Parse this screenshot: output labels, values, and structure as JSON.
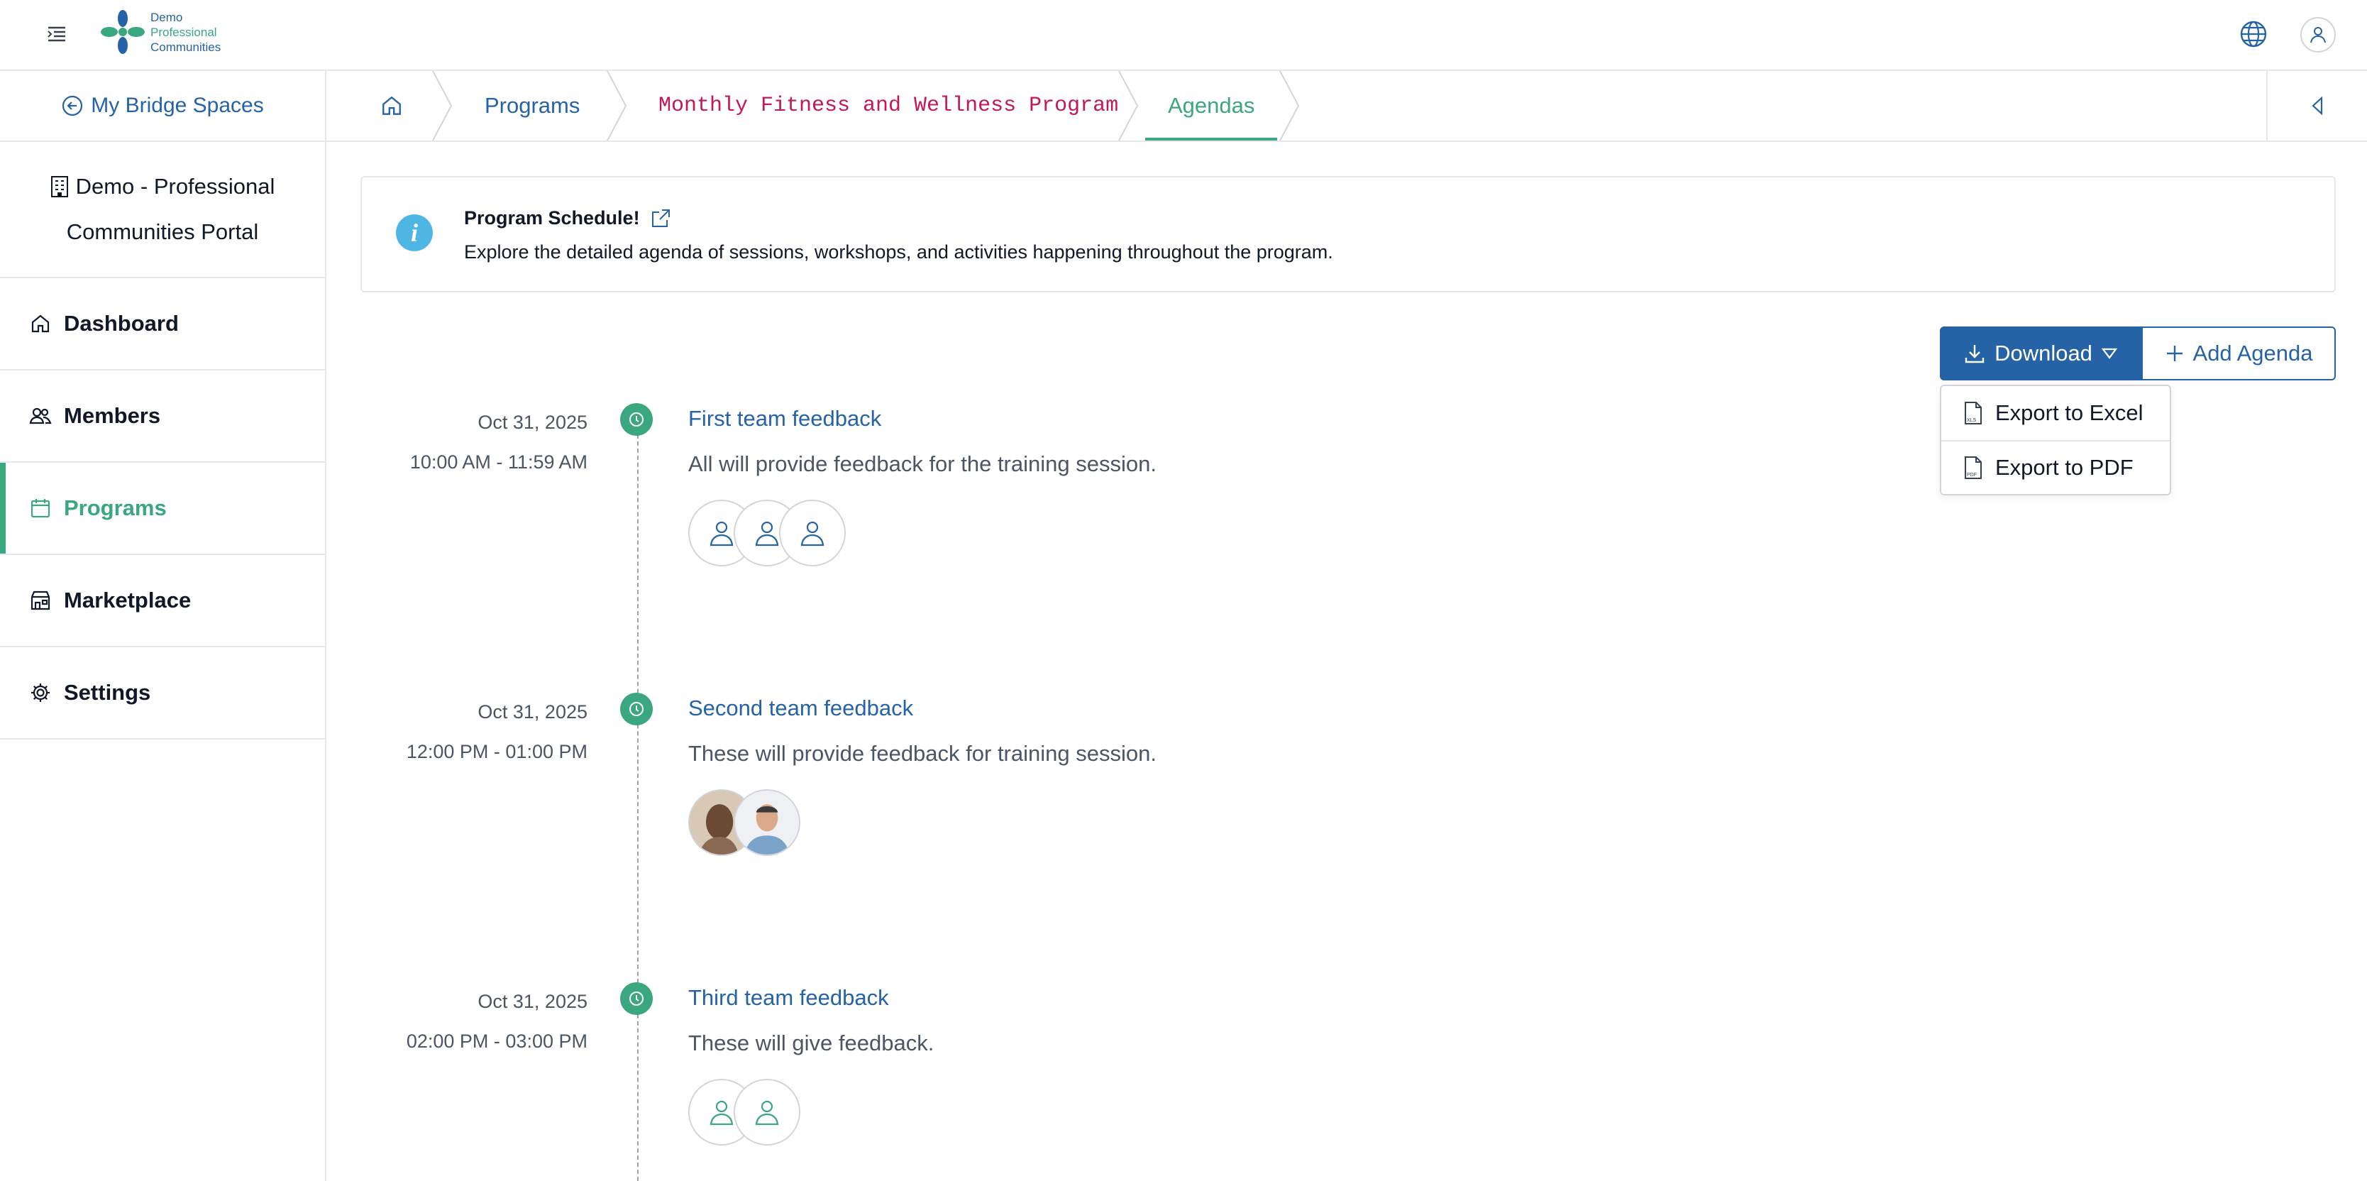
{
  "header": {
    "logo": {
      "line1": "Demo",
      "line2": "Professional",
      "line3": "Communities"
    },
    "icons": [
      "menu-toggle-icon",
      "globe-icon",
      "user-icon"
    ]
  },
  "sidebar": {
    "back_label": "My Bridge Spaces",
    "org_line1": "Demo - Professional",
    "org_line2": "Communities Portal",
    "items": [
      {
        "label": "Dashboard",
        "icon": "home-icon",
        "active": false
      },
      {
        "label": "Members",
        "icon": "users-icon",
        "active": false
      },
      {
        "label": "Programs",
        "icon": "calendar-icon",
        "active": true
      },
      {
        "label": "Marketplace",
        "icon": "store-icon",
        "active": false
      },
      {
        "label": "Settings",
        "icon": "gear-icon",
        "active": false
      }
    ]
  },
  "breadcrumb": {
    "home_icon": "home-icon",
    "items": [
      "Programs",
      "Monthly Fitness and Wellness Program",
      "Agendas"
    ]
  },
  "banner": {
    "title": "Program Schedule!",
    "description": "Explore the detailed agenda of sessions, workshops, and activities happening throughout the program."
  },
  "actions": {
    "download_label": "Download",
    "add_label": "Add Agenda",
    "dropdown": [
      "Export to Excel",
      "Export to PDF"
    ]
  },
  "agendas": [
    {
      "date": "Oct 31, 2025",
      "time": "10:00 AM - 11:59 AM",
      "title": "First team feedback",
      "description": "All will provide feedback for the training session.",
      "attendees": [
        "placeholder",
        "placeholder",
        "placeholder"
      ]
    },
    {
      "date": "Oct 31, 2025",
      "time": "12:00 PM - 01:00 PM",
      "title": "Second team feedback",
      "description": "These will provide feedback for training session.",
      "attendees": [
        "photo",
        "photo"
      ]
    },
    {
      "date": "Oct 31, 2025",
      "time": "02:00 PM - 03:00 PM",
      "title": "Third team feedback",
      "description": "These will give feedback.",
      "attendees": [
        "placeholder",
        "placeholder"
      ]
    }
  ],
  "colors": {
    "primary": "#2563a6",
    "accent": "#3aa77e",
    "breadcrumb_program": "#c2185b",
    "info": "#4fb6e3"
  }
}
